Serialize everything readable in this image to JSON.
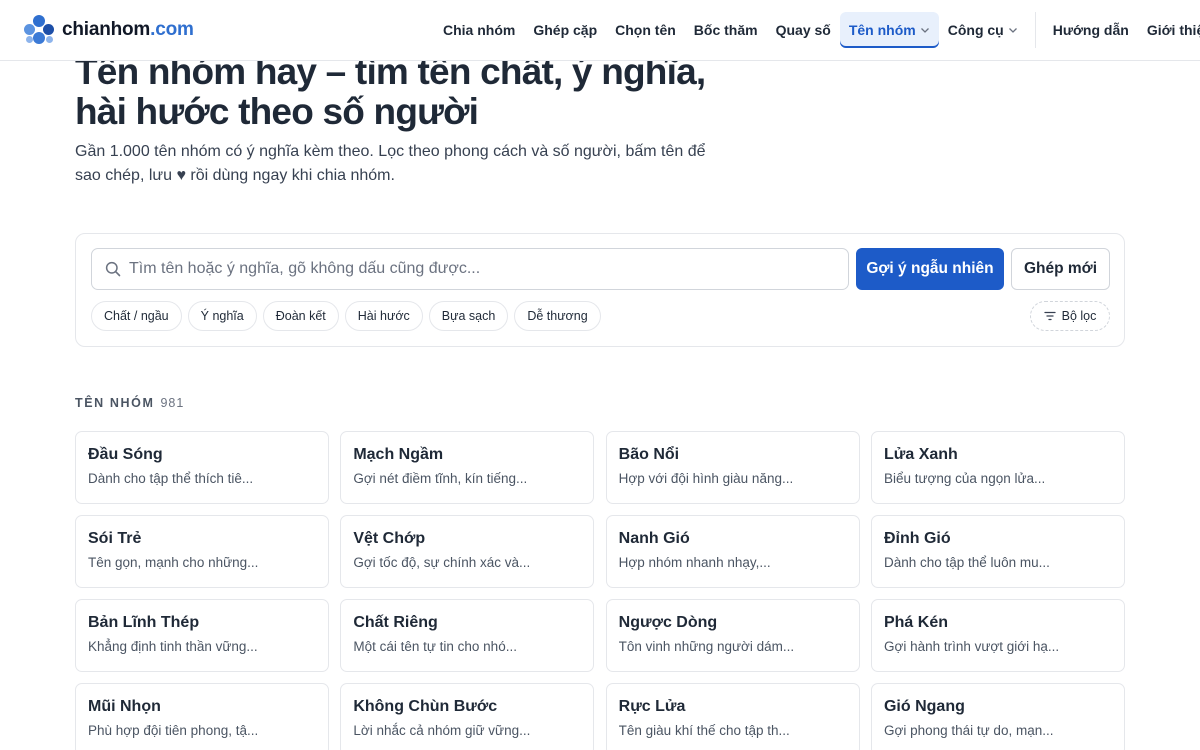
{
  "brand": {
    "name": "chianhom",
    "tld": ".com"
  },
  "nav": {
    "items": [
      {
        "label": "Chia nhóm"
      },
      {
        "label": "Ghép cặp"
      },
      {
        "label": "Chọn tên"
      },
      {
        "label": "Bốc thăm"
      },
      {
        "label": "Quay số"
      },
      {
        "label": "Tên nhóm"
      },
      {
        "label": "Công cụ"
      }
    ],
    "secondary": [
      {
        "label": "Hướng dẫn"
      },
      {
        "label": "Giới thiệu"
      }
    ]
  },
  "hero": {
    "title": "Tên nhóm hay – tìm tên chất, ý nghĩa, hài hước theo số người",
    "subtitle": "Gần 1.000 tên nhóm có ý nghĩa kèm theo. Lọc theo phong cách và số người, bấm tên để sao chép, lưu ♥ rồi dùng ngay khi chia nhóm."
  },
  "search": {
    "placeholder": "Tìm tên hoặc ý nghĩa, gõ không dấu cũng được...",
    "value": "",
    "random_label": "Gợi ý ngẫu nhiên",
    "new_label": "Ghép mới",
    "chips": [
      {
        "label": "Chất / ngầu"
      },
      {
        "label": "Ý nghĩa"
      },
      {
        "label": "Đoàn kết"
      },
      {
        "label": "Hài hước"
      },
      {
        "label": "Bựa sạch"
      },
      {
        "label": "Dễ thương"
      }
    ],
    "filter_label": "Bộ lọc"
  },
  "results": {
    "heading": "Tên nhóm",
    "count": "981",
    "cards": [
      {
        "title": "Đầu Sóng",
        "desc": "Dành cho tập thể thích tiê..."
      },
      {
        "title": "Mạch Ngầm",
        "desc": "Gợi nét điềm tĩnh, kín tiếng..."
      },
      {
        "title": "Bão Nổi",
        "desc": "Hợp với đội hình giàu năng..."
      },
      {
        "title": "Lửa Xanh",
        "desc": "Biểu tượng của ngọn lửa..."
      },
      {
        "title": "Sói Trẻ",
        "desc": "Tên gọn, mạnh cho những..."
      },
      {
        "title": "Vệt Chớp",
        "desc": "Gợi tốc độ, sự chính xác và..."
      },
      {
        "title": "Nanh Gió",
        "desc": "Hợp nhóm nhanh nhạy,..."
      },
      {
        "title": "Đỉnh Gió",
        "desc": "Dành cho tập thể luôn mu..."
      },
      {
        "title": "Bản Lĩnh Thép",
        "desc": "Khẳng định tinh thần vững..."
      },
      {
        "title": "Chất Riêng",
        "desc": "Một cái tên tự tin cho nhó..."
      },
      {
        "title": "Ngược Dòng",
        "desc": "Tôn vinh những người dám..."
      },
      {
        "title": "Phá Kén",
        "desc": "Gợi hành trình vượt giới hạ..."
      },
      {
        "title": "Mũi Nhọn",
        "desc": "Phù hợp đội tiên phong, tậ..."
      },
      {
        "title": "Không Chùn Bước",
        "desc": "Lời nhắc cả nhóm giữ vững..."
      },
      {
        "title": "Rực Lửa",
        "desc": "Tên giàu khí thế cho tập th..."
      },
      {
        "title": "Gió Ngang",
        "desc": "Gợi phong thái tự do, mạn..."
      }
    ]
  },
  "colors": {
    "accent": "#1d5bc8",
    "accent_bg": "#e8f0fc",
    "logo_blue": "#2f6fcf"
  }
}
